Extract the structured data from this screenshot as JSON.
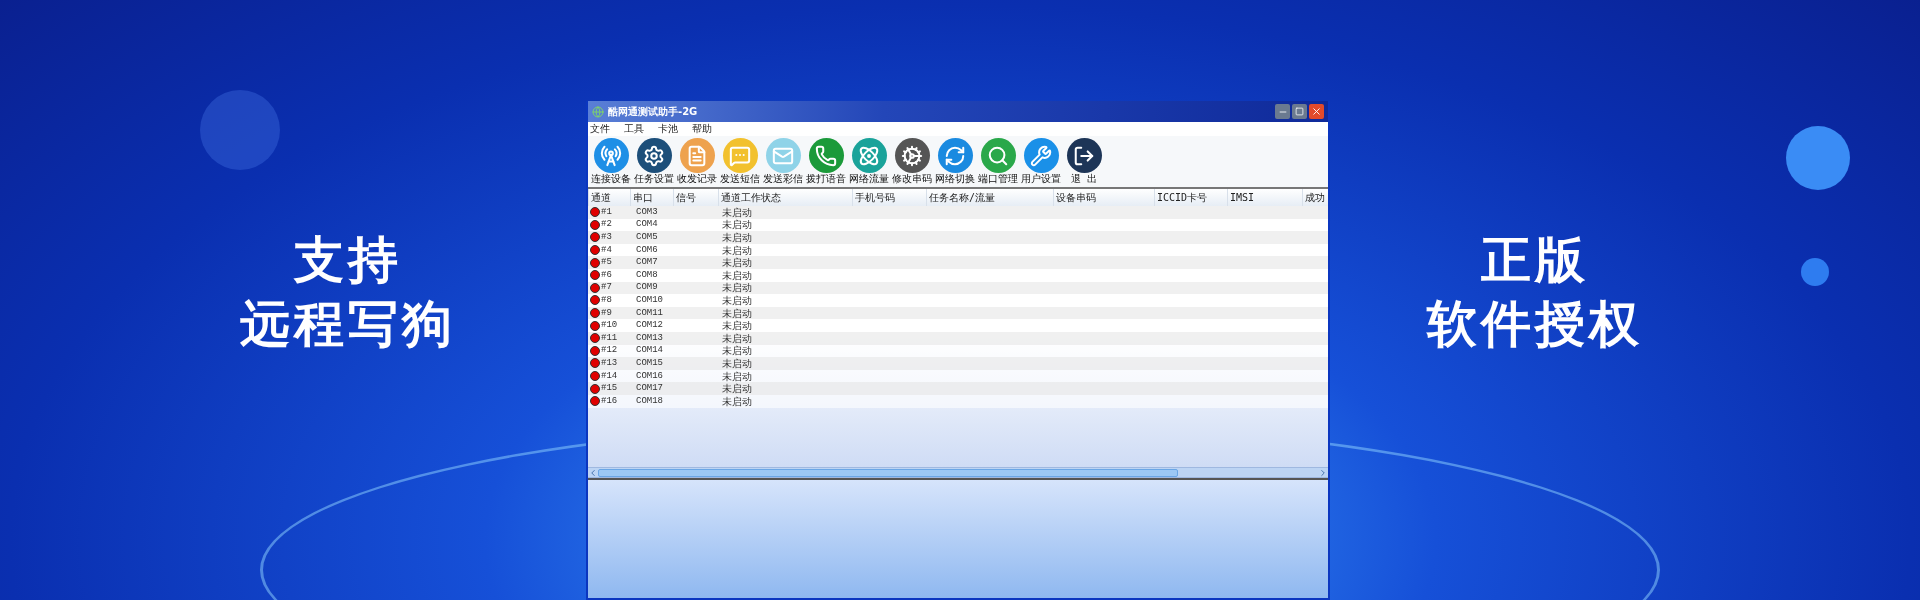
{
  "slogan_left": [
    "支持",
    "远程写狗"
  ],
  "slogan_right": [
    "正版",
    "软件授权"
  ],
  "window": {
    "title": "酷网通测试助手-2G"
  },
  "menu": [
    "文件",
    "工具",
    "卡池",
    "帮助"
  ],
  "toolbar": [
    {
      "label": "连接设备"
    },
    {
      "label": "任务设置"
    },
    {
      "label": "收发记录"
    },
    {
      "label": "发送短信"
    },
    {
      "label": "发送彩信"
    },
    {
      "label": "拨打语音"
    },
    {
      "label": "网络流量"
    },
    {
      "label": "修改串码"
    },
    {
      "label": "网络切换"
    },
    {
      "label": "端口管理"
    },
    {
      "label": "用户设置"
    },
    {
      "label": "退  出"
    }
  ],
  "table": {
    "columns": [
      "通道",
      "串口",
      "信号",
      "通道工作状态",
      "手机号码",
      "任务名称/流量",
      "设备串码",
      "ICCID卡号",
      "IMSI",
      "成功"
    ],
    "rows": [
      {
        "channel": "#1",
        "port": "COM3",
        "status": "未启动",
        "color": "#e00000"
      },
      {
        "channel": "#2",
        "port": "COM4",
        "status": "未启动",
        "color": "#e00000"
      },
      {
        "channel": "#3",
        "port": "COM5",
        "status": "未启动",
        "color": "#e00000"
      },
      {
        "channel": "#4",
        "port": "COM6",
        "status": "未启动",
        "color": "#e00000"
      },
      {
        "channel": "#5",
        "port": "COM7",
        "status": "未启动",
        "color": "#e00000"
      },
      {
        "channel": "#6",
        "port": "COM8",
        "status": "未启动",
        "color": "#e00000"
      },
      {
        "channel": "#7",
        "port": "COM9",
        "status": "未启动",
        "color": "#e00000"
      },
      {
        "channel": "#8",
        "port": "COM10",
        "status": "未启动",
        "color": "#e00000"
      },
      {
        "channel": "#9",
        "port": "COM11",
        "status": "未启动",
        "color": "#e00000"
      },
      {
        "channel": "#10",
        "port": "COM12",
        "status": "未启动",
        "color": "#e00000"
      },
      {
        "channel": "#11",
        "port": "COM13",
        "status": "未启动",
        "color": "#e00000"
      },
      {
        "channel": "#12",
        "port": "COM14",
        "status": "未启动",
        "color": "#e00000"
      },
      {
        "channel": "#13",
        "port": "COM15",
        "status": "未启动",
        "color": "#e00000"
      },
      {
        "channel": "#14",
        "port": "COM16",
        "status": "未启动",
        "color": "#e00000"
      },
      {
        "channel": "#15",
        "port": "COM17",
        "status": "未启动",
        "color": "#e00000"
      },
      {
        "channel": "#16",
        "port": "COM18",
        "status": "未启动",
        "color": "#e00000"
      }
    ]
  }
}
